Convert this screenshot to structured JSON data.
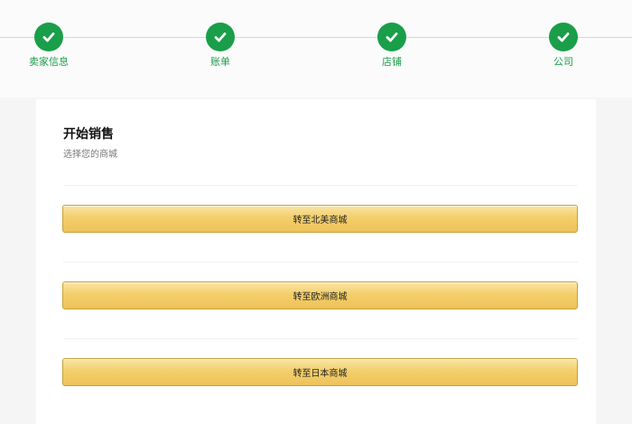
{
  "steps": [
    {
      "label": "卖家信息"
    },
    {
      "label": "账单"
    },
    {
      "label": "店铺"
    },
    {
      "label": "公司"
    }
  ],
  "colors": {
    "step_complete": "#1a9e49",
    "button_gold": "#f3cf6b"
  },
  "icons": {
    "step_complete": "checkmark-icon"
  },
  "card": {
    "title": "开始销售",
    "subtitle": "选择您的商城"
  },
  "buttons": [
    {
      "label": "转至北美商城"
    },
    {
      "label": "转至欧洲商城"
    },
    {
      "label": "转至日本商城"
    }
  ]
}
